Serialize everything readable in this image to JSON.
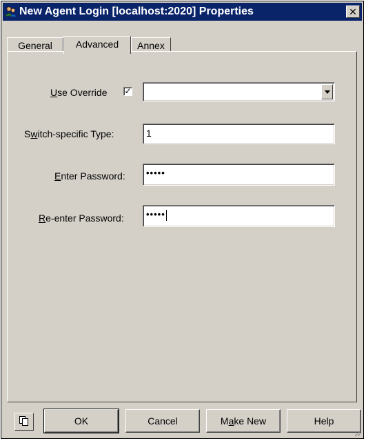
{
  "window": {
    "title": "New Agent Login [localhost:2020] Properties",
    "title_icon": "agent-login-icon",
    "close_icon": "close-icon"
  },
  "tabs": [
    {
      "label": "General",
      "active": false
    },
    {
      "label": "Advanced",
      "active": true
    },
    {
      "label": "Annex",
      "active": false
    }
  ],
  "form": {
    "use_override": {
      "label_mnemonic": "U",
      "label_rest": "se Override",
      "checked": true,
      "check_mark": "✓",
      "selected_value": ""
    },
    "switch_type": {
      "label_before": "S",
      "label_mnemonic": "w",
      "label_after": "itch-specific Type:",
      "value": "1"
    },
    "enter_password": {
      "label_mnemonic": "E",
      "label_rest": "nter Password:",
      "value_masked": "•••••"
    },
    "reenter_password": {
      "label_mnemonic": "R",
      "label_rest": "e-enter Password:",
      "value_masked": "•••••"
    }
  },
  "buttons": {
    "copy_icon": "copy-icon",
    "ok": "OK",
    "cancel": "Cancel",
    "make_new_before": "M",
    "make_new_mnemonic": "a",
    "make_new_after": "ke New",
    "help": "Help"
  },
  "colors": {
    "face": "#d4d0c8",
    "titlebar": "#0a246a",
    "field": "#ffffff"
  }
}
